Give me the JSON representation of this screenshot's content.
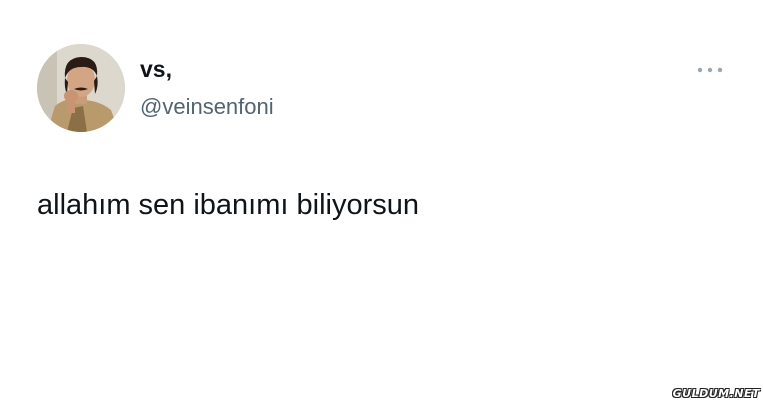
{
  "tweet": {
    "display_name": "vs,",
    "handle": "@veinsenfoni",
    "text": "allahım sen ibanımı biliyorsun",
    "more_icon": "more-horizontal-icon"
  },
  "watermark": {
    "text": "GULDUM.NET"
  }
}
